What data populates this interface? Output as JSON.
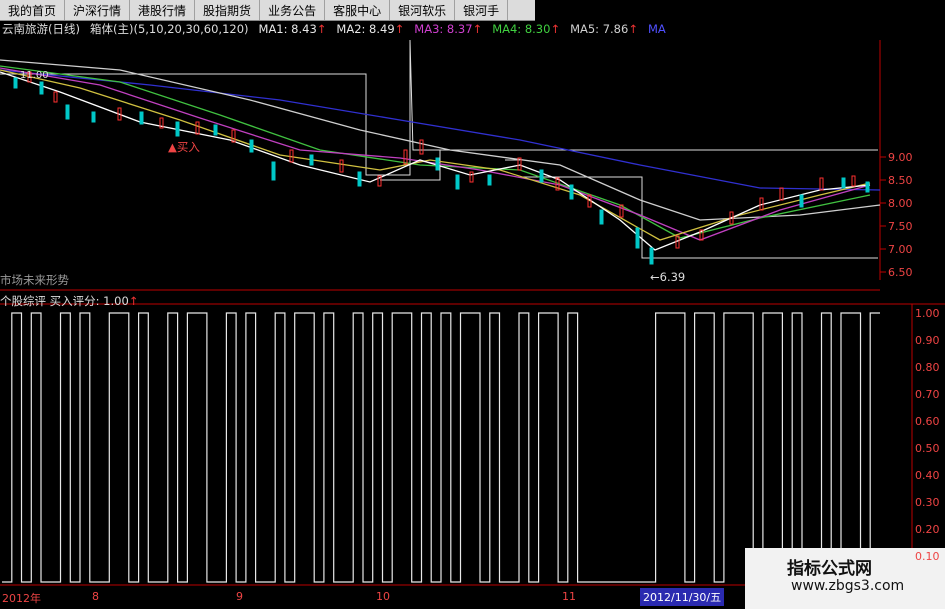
{
  "menu": [
    "我的首页",
    "沪深行情",
    "港股行情",
    "股指期货",
    "业务公告",
    "客服中心",
    "银河软乐",
    "银河手"
  ],
  "title": {
    "stock": "云南旅游(日线)",
    "indicator": "箱体(主)(5,10,20,30,60,120)",
    "ma": [
      {
        "label": "MA1: 8.43",
        "color": "#e8e8e8"
      },
      {
        "label": "MA2: 8.49",
        "color": "#e8e8e8"
      },
      {
        "label": "MA3: 8.37",
        "color": "#d040d0"
      },
      {
        "label": "MA4: 8.30",
        "color": "#40d040"
      },
      {
        "label": "MA5: 7.86",
        "color": "#d0d0d0"
      },
      {
        "label": "MA",
        "color": "#5050ff"
      }
    ]
  },
  "price_axis": [
    "9.00",
    "8.50",
    "8.00",
    "7.50",
    "7.00",
    "6.50"
  ],
  "annotations": {
    "buy": "▲买入",
    "low": "←6.39",
    "price_top": "11.00",
    "future": "市场未来形势"
  },
  "panel": {
    "title": "个股综评  买入评分: 1.00"
  },
  "score_axis": [
    "1.00",
    "0.90",
    "0.80",
    "0.70",
    "0.60",
    "0.50",
    "0.40",
    "0.30",
    "0.20",
    "0.10"
  ],
  "dates": {
    "d1": "2012年",
    "d2": "8",
    "d3": "9",
    "d4": "10",
    "d5": "11",
    "badge": "2012/11/30/五"
  },
  "watermark": {
    "line1": "指标公式网",
    "line2": "www.zbgs3.com"
  },
  "chart_data": {
    "type": "line",
    "score_series": [
      0,
      1,
      0,
      1,
      0,
      0,
      1,
      0,
      1,
      0,
      0,
      1,
      1,
      0,
      1,
      0,
      0,
      1,
      0,
      1,
      1,
      0,
      0,
      1,
      0,
      1,
      0,
      0,
      1,
      0,
      1,
      1,
      0,
      1,
      0,
      0,
      1,
      0,
      1,
      0,
      1,
      1,
      0,
      1,
      0,
      1,
      0,
      1,
      1,
      0,
      1,
      0,
      0,
      1,
      0,
      1,
      1,
      0,
      1,
      0,
      0,
      0,
      0,
      0,
      0,
      0,
      0,
      1,
      1,
      1,
      0,
      1,
      1,
      0,
      1,
      1,
      1,
      0,
      1,
      1,
      0,
      1,
      0,
      0,
      1,
      0,
      1,
      1,
      0,
      1
    ]
  }
}
